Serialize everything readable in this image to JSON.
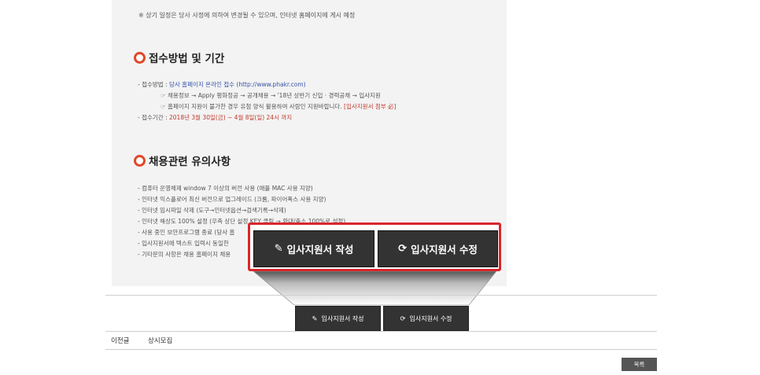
{
  "notice": "※ 상기 일정은 당사 사정에 의하여 변경될 수 있으며, 인터넷 홈페이지에 게시 예정",
  "section1": {
    "title": "접수방법 및 기간",
    "method_prefix": "- 접수방법 : ",
    "method_value": "당사 홈페이지 온라인 접수 (http://www.phakr.com)",
    "step1": "☞ 채용정보 → Apply 평화정공 → 공개채용 → '18년 상반기 신입 · 경력공채 → 입사지원",
    "step2_text": "☞ 홈페이지 지원이 불가한 경우 유첨 양식 활용하여 사람인 지원바랍니다. ",
    "step2_red": "[입사지원서 첨부 必]",
    "period_prefix": "- 접수기간 : ",
    "period_value": "2018년 3월 30일(금) ~ 4월 8일(일) 24시 까지"
  },
  "section2": {
    "title": "채용관련 유의사항",
    "items": [
      "- 컴퓨터 운영체제 window 7 이상의 버전 사용 (애플 MAC 사용 지양)",
      "- 인터넷 익스플로어 최신 버전으로 업그레이드 (크롬, 파이어폭스 사용 지양)",
      "- 인터넷 임시파일 삭제 (도구→인터넷옵션→검색기록→삭제)",
      "- 인터넷 해상도 100% 설정 (우측 상단 설정 KEY 클릭 → 확대/축소 100%로 설정)",
      "- 사용 중인 보안프로그램 종료 (당사 홈",
      "- 입사지원서에 텍스트 입력시 동일한",
      "- 기타문의 사항은 채용 홈페이지 채용"
    ]
  },
  "buttons": {
    "write_label": "입사지원서 작성",
    "edit_label": "입사지원서 수정",
    "write_icon": "edit-icon",
    "edit_icon": "refresh-icon"
  },
  "nav": {
    "prev_label": "이전글",
    "prev_title": "상시모집",
    "list_label": "목록"
  },
  "colors": {
    "accent_red": "#d9262b",
    "button_dark": "#333333",
    "link_blue": "#3554a8"
  }
}
